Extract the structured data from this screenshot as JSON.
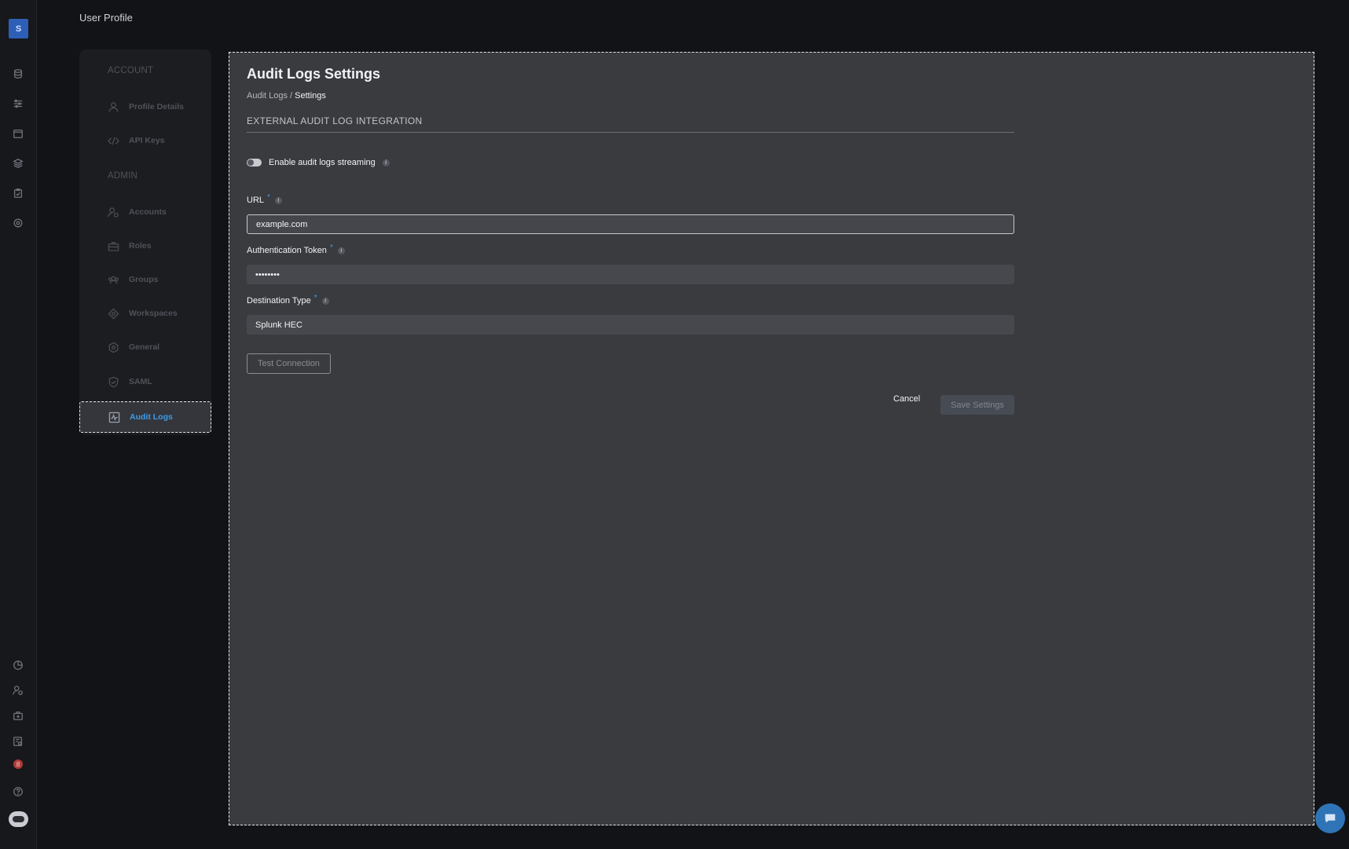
{
  "rail": {
    "avatar_letter": "S",
    "top_icons": [
      "database-icon",
      "sliders-icon",
      "calendar-icon",
      "layers-icon",
      "clipboard-icon",
      "settings-circle-icon"
    ],
    "bottom_icons": [
      "pie-chart-icon",
      "user-gear-icon",
      "briefcase-icon",
      "document-gear-icon",
      "notification-icon",
      "help-icon",
      "assistant-icon"
    ],
    "notification_count": "8"
  },
  "header": {
    "title": "User Profile"
  },
  "nav": {
    "account_heading": "ACCOUNT",
    "account_items": [
      {
        "label": "Profile Details",
        "icon": "user-icon"
      },
      {
        "label": "API Keys",
        "icon": "code-icon"
      }
    ],
    "admin_heading": "ADMIN",
    "admin_items": [
      {
        "label": "Accounts",
        "icon": "user-gear-icon"
      },
      {
        "label": "Roles",
        "icon": "briefcase-icon"
      },
      {
        "label": "Groups",
        "icon": "users-icon"
      },
      {
        "label": "Workspaces",
        "icon": "workspace-icon"
      },
      {
        "label": "General",
        "icon": "gear-icon"
      },
      {
        "label": "SAML",
        "icon": "shield-icon"
      },
      {
        "label": "Audit Logs",
        "icon": "activity-icon"
      }
    ],
    "active_item": "Audit Logs",
    "active_color": "#3f9be8"
  },
  "main": {
    "title": "Audit Logs Settings",
    "breadcrumb": {
      "parent": "Audit Logs",
      "separator": " / ",
      "current": "Settings"
    },
    "section_title": "EXTERNAL AUDIT LOG INTEGRATION",
    "toggle": {
      "label": "Enable audit logs streaming",
      "enabled": false
    },
    "url": {
      "label": "URL",
      "required": "*",
      "value": "example.com"
    },
    "token": {
      "label": "Authentication Token",
      "required": "*",
      "value": "••••••••"
    },
    "destination": {
      "label": "Destination Type",
      "required": "*",
      "value": "Splunk HEC"
    },
    "test_button": "Test Connection",
    "cancel_button": "Cancel",
    "save_button": "Save Settings"
  }
}
